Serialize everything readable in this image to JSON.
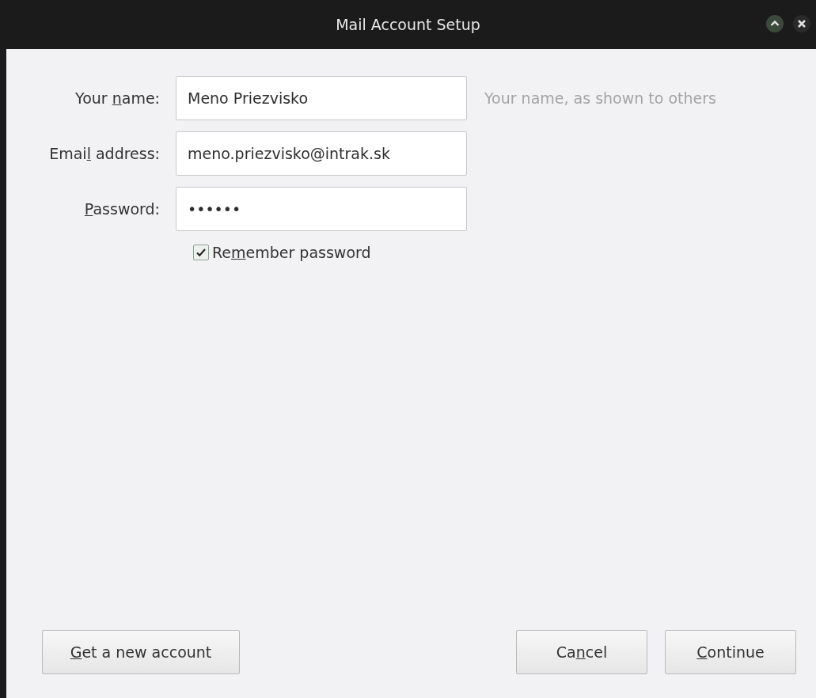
{
  "window": {
    "title": "Mail Account Setup"
  },
  "fields": [
    {
      "label": {
        "before": "Your ",
        "key": "n",
        "after": "ame:"
      },
      "value": "Meno Priezvisko",
      "hint": "Your name, as shown to others"
    },
    {
      "label": {
        "before": "Emai",
        "key": "l",
        "after": " address:"
      },
      "value": "meno.priezvisko@intrak.sk"
    },
    {
      "label": {
        "key": "P",
        "after": "assword:"
      },
      "value": "••••••"
    }
  ],
  "remember": {
    "label": {
      "before": "Re",
      "key": "m",
      "after": "ember password"
    },
    "checked": true
  },
  "buttons": [
    {
      "label": {
        "key": "G",
        "after": "et a new account"
      },
      "kind": "extra"
    },
    {
      "label": {
        "before": "Ca",
        "key": "n",
        "after": "cel"
      },
      "kind": "action"
    },
    {
      "label": {
        "key": "C",
        "after": "ontinue"
      },
      "kind": "action"
    }
  ]
}
